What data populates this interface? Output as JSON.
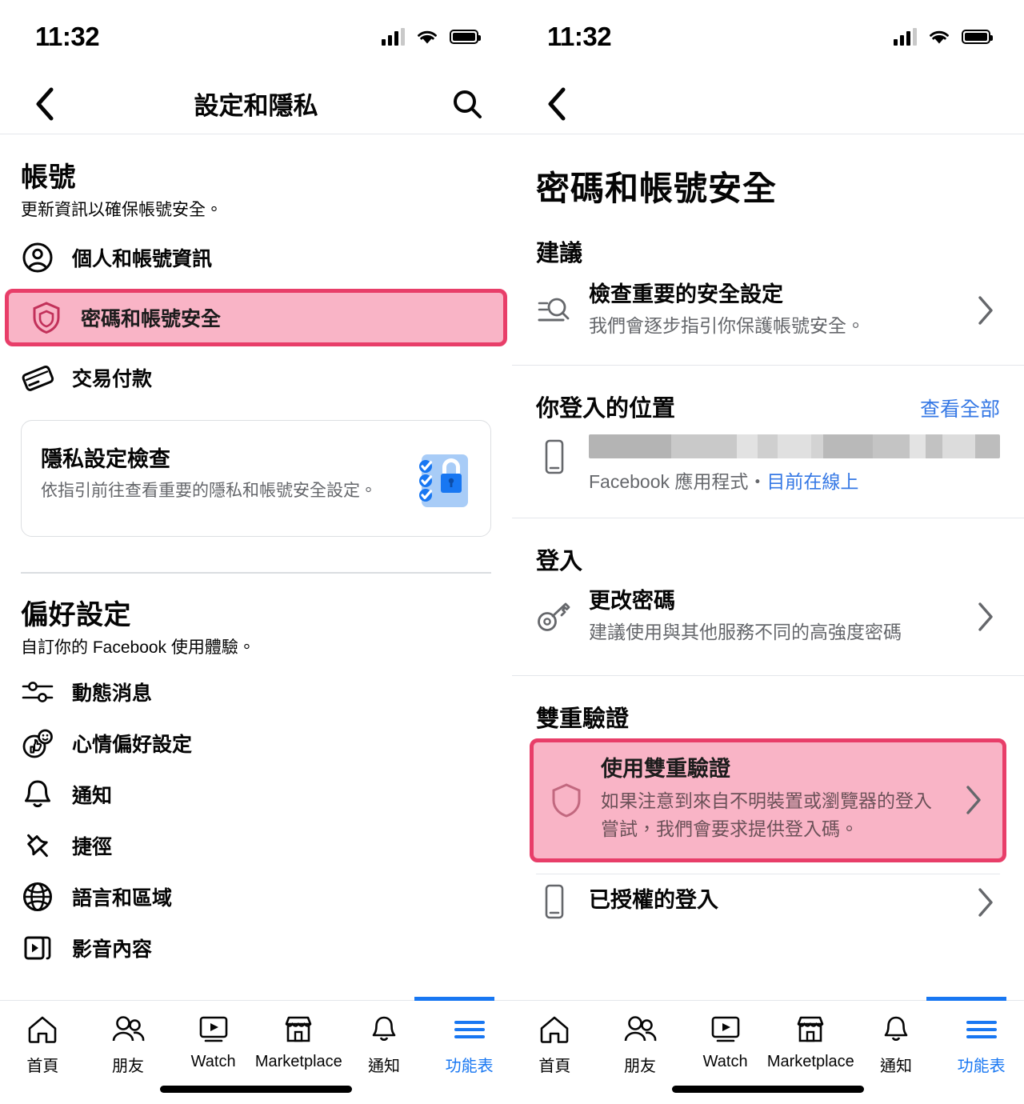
{
  "status_bar": {
    "time": "11:32",
    "signal_icon": "signal-bars-icon",
    "wifi_icon": "wifi-icon",
    "battery_icon": "battery-icon"
  },
  "left_panel": {
    "nav": {
      "back_icon": "chevron-left-icon",
      "title": "設定和隱私",
      "search_icon": "search-icon"
    },
    "account_section": {
      "title": "帳號",
      "subtitle": "更新資訊以確保帳號安全。",
      "items": [
        {
          "label": "個人和帳號資訊",
          "icon": "person-circle-icon",
          "highlighted": false
        },
        {
          "label": "密碼和帳號安全",
          "icon": "shield-icon",
          "highlighted": true
        },
        {
          "label": "交易付款",
          "icon": "credit-card-icon",
          "highlighted": false
        }
      ]
    },
    "privacy_card": {
      "title": "隱私設定檢查",
      "description": "依指引前往查看重要的隱私和帳號安全設定。",
      "art_icon": "privacy-checkup-lock-icon"
    },
    "preferences_section": {
      "title": "偏好設定",
      "subtitle": "自訂你的 Facebook 使用體驗。",
      "items": [
        {
          "label": "動態消息",
          "icon": "sliders-icon"
        },
        {
          "label": "心情偏好設定",
          "icon": "thumbs-up-emoji-icon"
        },
        {
          "label": "通知",
          "icon": "bell-icon"
        },
        {
          "label": "捷徑",
          "icon": "pushpin-icon"
        },
        {
          "label": "語言和區域",
          "icon": "globe-icon"
        },
        {
          "label": "影音內容",
          "icon": "video-stack-icon"
        }
      ]
    }
  },
  "right_panel": {
    "nav": {
      "back_icon": "chevron-left-icon"
    },
    "page_title": "密碼和帳號安全",
    "suggestions": {
      "title": "建議",
      "items": [
        {
          "title": "檢查重要的安全設定",
          "description": "我們會逐步指引你保護帳號安全。",
          "icon": "security-checkup-search-icon",
          "chevron": "chevron-right-icon"
        }
      ]
    },
    "login_locations": {
      "title": "你登入的位置",
      "see_all": "查看全部",
      "device": {
        "icon": "mobile-device-icon",
        "name_redacted": true,
        "app_label": "Facebook 應用程式",
        "separator": "・",
        "status": "目前在線上"
      }
    },
    "login_section": {
      "title": "登入",
      "items": [
        {
          "title": "更改密碼",
          "description": "建議使用與其他服務不同的高強度密碼",
          "icon": "key-icon",
          "chevron": "chevron-right-icon"
        }
      ]
    },
    "two_factor_section": {
      "title": "雙重驗證",
      "items": [
        {
          "title": "使用雙重驗證",
          "description": "如果注意到來自不明裝置或瀏覽器的登入嘗試，我們會要求提供登入碼。",
          "icon": "shield-icon",
          "chevron": "chevron-right-icon",
          "highlighted": true
        },
        {
          "title": "已授權的登入",
          "description": "",
          "icon": "mobile-device-icon",
          "chevron": "chevron-right-icon",
          "highlighted": false
        }
      ]
    }
  },
  "tab_bar": {
    "tabs": [
      {
        "label": "首頁",
        "icon": "home-icon",
        "active": false
      },
      {
        "label": "朋友",
        "icon": "friends-icon",
        "active": false
      },
      {
        "label": "Watch",
        "icon": "watch-play-icon",
        "active": false
      },
      {
        "label": "Marketplace",
        "icon": "marketplace-store-icon",
        "active": false
      },
      {
        "label": "通知",
        "icon": "bell-icon",
        "active": false
      },
      {
        "label": "功能表",
        "icon": "hamburger-menu-icon",
        "active": true
      }
    ]
  },
  "colors": {
    "highlight_fill": "#f9b4c6",
    "highlight_border": "#e83e69",
    "link_blue": "#3578e5",
    "active_tab_blue": "#1877f2",
    "secondary_text": "#65676b"
  }
}
